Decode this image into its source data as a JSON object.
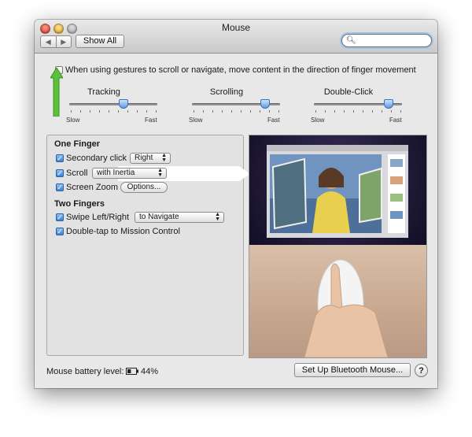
{
  "window": {
    "title": "Mouse",
    "show_all": "Show All",
    "nav_back": "◀",
    "nav_forward": "▶",
    "search_placeholder": ""
  },
  "scroll_direction": {
    "label": "When using gestures to scroll or navigate, move content in the direction of finger movement",
    "checked": false
  },
  "sliders": [
    {
      "title": "Tracking",
      "min_label": "Slow",
      "max_label": "Fast",
      "level": 0.62
    },
    {
      "title": "Scrolling",
      "min_label": "Slow",
      "max_label": "Fast",
      "level": 0.83
    },
    {
      "title": "Double-Click",
      "min_label": "Slow",
      "max_label": "Fast",
      "level": 0.85
    }
  ],
  "one_finger": {
    "heading": "One Finger",
    "secondary_click": {
      "label": "Secondary click",
      "checked": true,
      "value": "Right"
    },
    "scroll": {
      "label": "Scroll",
      "checked": true,
      "value": "with Inertia"
    },
    "screen_zoom": {
      "label": "Screen Zoom",
      "checked": true,
      "button": "Options..."
    }
  },
  "two_fingers": {
    "heading": "Two Fingers",
    "swipe": {
      "label": "Swipe Left/Right",
      "checked": true,
      "value": "to Navigate"
    },
    "double_tap": {
      "label": "Double-tap to Mission Control",
      "checked": true
    }
  },
  "footer": {
    "battery_label": "Mouse battery level:",
    "battery_percent": "44%",
    "setup_button": "Set Up Bluetooth Mouse...",
    "help": "?"
  },
  "colors": {
    "accent": "#3c81d6",
    "arrow": "#5cc03a"
  }
}
